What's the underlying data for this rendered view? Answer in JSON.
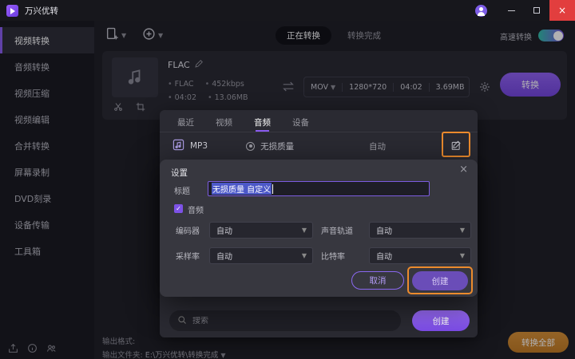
{
  "app": {
    "title": "万兴优转"
  },
  "sidebar": {
    "items": [
      {
        "label": "视频转换"
      },
      {
        "label": "音频转换"
      },
      {
        "label": "视频压缩"
      },
      {
        "label": "视频编辑"
      },
      {
        "label": "合并转换"
      },
      {
        "label": "屏幕录制"
      },
      {
        "label": "DVD刻录"
      },
      {
        "label": "设备传输"
      },
      {
        "label": "工具箱"
      }
    ]
  },
  "toolbar": {
    "tab_converting": "正在转换",
    "tab_finished": "转换完成",
    "highspeed_label": "高速转换"
  },
  "task": {
    "name": "FLAC",
    "src_format": "FLAC",
    "src_bitrate": "452kbps",
    "src_duration": "04:02",
    "src_size": "13.06MB",
    "out_format": "MOV",
    "out_resolution": "1280*720",
    "out_duration": "04:02",
    "out_size": "3.69MB",
    "convert_label": "转换"
  },
  "format_panel": {
    "tab_recent": "最近",
    "tab_video": "视频",
    "tab_audio": "音频",
    "tab_device": "设备",
    "format": "MP3",
    "quality": "无损质量",
    "value": "自动"
  },
  "dialog": {
    "title": "设置",
    "name_label": "标题",
    "name_value": "无损质量 自定义",
    "audio_label": "音频",
    "encoder_label": "编码器",
    "encoder_value": "自动",
    "track_label": "声音轨道",
    "track_value": "自动",
    "sample_label": "采样率",
    "sample_value": "自动",
    "bitrate_label": "比特率",
    "bitrate_value": "自动",
    "cancel_label": "取消",
    "create_label": "创建"
  },
  "panel_footer": {
    "search_placeholder": "搜索",
    "create_label": "创建"
  },
  "statusbar": {
    "format_label": "输出格式:",
    "folder_label": "输出文件夹:",
    "folder_value": "E:\\万兴优转\\转换完成",
    "convert_all_label": "转换全部"
  },
  "colors": {
    "accent": "#8a5cf0",
    "highlight": "#ec8b2d",
    "close": "#e23e3e"
  }
}
